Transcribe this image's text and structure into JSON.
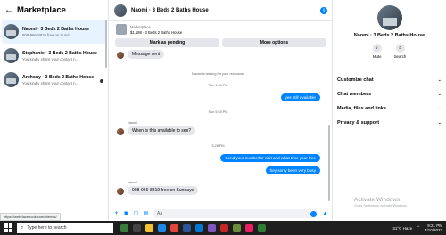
{
  "sidebar": {
    "title": "Marketplace",
    "conversations": [
      {
        "name": "Naomi · 3 Beds 2 Baths House",
        "preview": "908-966-8819 free on Sund..."
      },
      {
        "name": "Stephanie · 3 Beds 2 Baths House",
        "preview": "You kindly share your contact n..."
      },
      {
        "name": "Anthony · 3 Beds 2 Baths House",
        "preview": "You kindly share your contact n..."
      }
    ],
    "status_url": "https://web.facebook.com/friends/"
  },
  "chat": {
    "title": "Naomi · 3 Beds 2 Baths House",
    "listing_category": "Marketplace",
    "listing_detail": "$1,198 · 3 Beds 2 Baths House",
    "mark_pending_label": "Mark as pending",
    "more_options_label": "More options",
    "messages": {
      "m1": "Message sent",
      "sys1": "Naomi is waiting for your response.",
      "ts1": "Sun 4:46 PM",
      "m2": "yes still available",
      "ts2": "Sun 5:53 PM",
      "sender1": "Naomi",
      "m3": "When is this available to see?",
      "ts3": "3:28 PM",
      "m4": "Send your numberfor visit and what time your free",
      "m5": "hey sorry been very busy",
      "sender2": "Naomi",
      "m6": "908-966-8819 free on Sundays"
    },
    "composer_placeholder": "Aa"
  },
  "right_panel": {
    "name": "Naomi · 3 Beds 2 Baths House",
    "mute_label": "Mute",
    "search_label": "Search",
    "menu": [
      "Customize chat",
      "Chat members",
      "Media, files and links",
      "Privacy & support"
    ]
  },
  "watermark": {
    "title": "Activate Windows",
    "subtitle": "Go to Settings to activate Windows."
  },
  "taskbar": {
    "search_placeholder": "Type here to search",
    "weather": "31°C  Haze",
    "time": "9:21 PM",
    "date": "4/10/2023"
  }
}
